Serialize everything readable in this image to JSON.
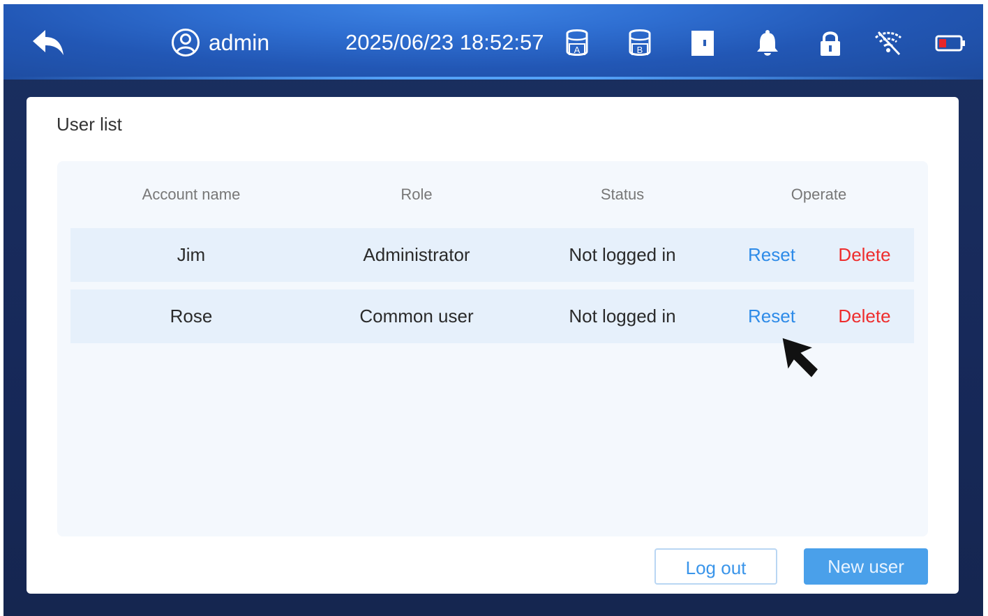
{
  "header": {
    "back_icon": "back-arrow-icon",
    "user_icon": "user-circle-icon",
    "username": "admin",
    "datetime": "2025/06/23 18:52:57",
    "status_icons": [
      "tank-a-icon",
      "tank-b-icon",
      "door-icon",
      "bell-icon",
      "lock-icon",
      "wifi-off-icon",
      "battery-low-icon"
    ],
    "colors": {
      "bar": "#2f6fd2",
      "battery_alert": "#e8262a"
    }
  },
  "user_list": {
    "title": "User list",
    "columns": [
      "Account name",
      "Role",
      "Status",
      "Operate"
    ],
    "rows": [
      {
        "account": "Jim",
        "role": "Administrator",
        "status": "Not logged in",
        "reset": "Reset",
        "delete": "Delete"
      },
      {
        "account": "Rose",
        "role": "Common user",
        "status": "Not logged in",
        "reset": "Reset",
        "delete": "Delete"
      }
    ]
  },
  "footer": {
    "logout_label": "Log out",
    "new_user_label": "New user"
  },
  "colors": {
    "reset_link": "#2e8be8",
    "delete_link": "#ee2d2d",
    "primary_button": "#4aa0ea",
    "row_background": "#e6f0fb"
  }
}
